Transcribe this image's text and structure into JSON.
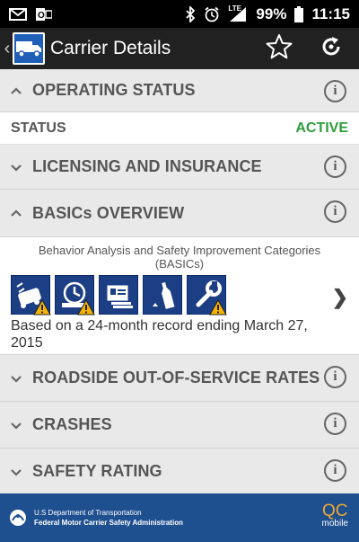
{
  "statusbar": {
    "battery": "99%",
    "time": "11:15",
    "network": "LTE",
    "icons": [
      "gmail-icon",
      "outlook-icon",
      "bluetooth-icon",
      "alarm-icon",
      "signal-icon",
      "battery-icon"
    ]
  },
  "actionbar": {
    "title": "Carrier Details",
    "icons": [
      "back-icon",
      "truck-logo-icon",
      "star-icon",
      "refresh-icon"
    ]
  },
  "sections": {
    "operating_status": "OPERATING STATUS",
    "licensing": "LICENSING AND INSURANCE",
    "basics": "BASICs OVERVIEW",
    "roadside": "ROADSIDE OUT-OF-SERVICE RATES",
    "crashes": "CRASHES",
    "safety_rating": "SAFETY RATING"
  },
  "status": {
    "label": "STATUS",
    "value": "ACTIVE",
    "value_color": "#2e9e3c"
  },
  "basics_panel": {
    "caption_line1": "Behavior Analysis and Safety Improvement Categories",
    "caption_line2": "(BASICs)",
    "record_note": "Based on a 24-month record ending March 27, 2015",
    "icons": [
      "unsafe-driving-icon",
      "hours-of-service-icon",
      "driver-fitness-icon",
      "controlled-substances-icon",
      "vehicle-maintenance-icon"
    ]
  },
  "footer": {
    "line1": "U.S Department of Transportation",
    "line2": "Federal Motor Carrier Safety Administration",
    "brand": "QC",
    "brand_sub": "mobile"
  },
  "colors": {
    "actionbar": "#212121",
    "footer": "#1e4f8f",
    "section_bg": "#e9e9e9",
    "accent_orange": "#f0a830"
  }
}
